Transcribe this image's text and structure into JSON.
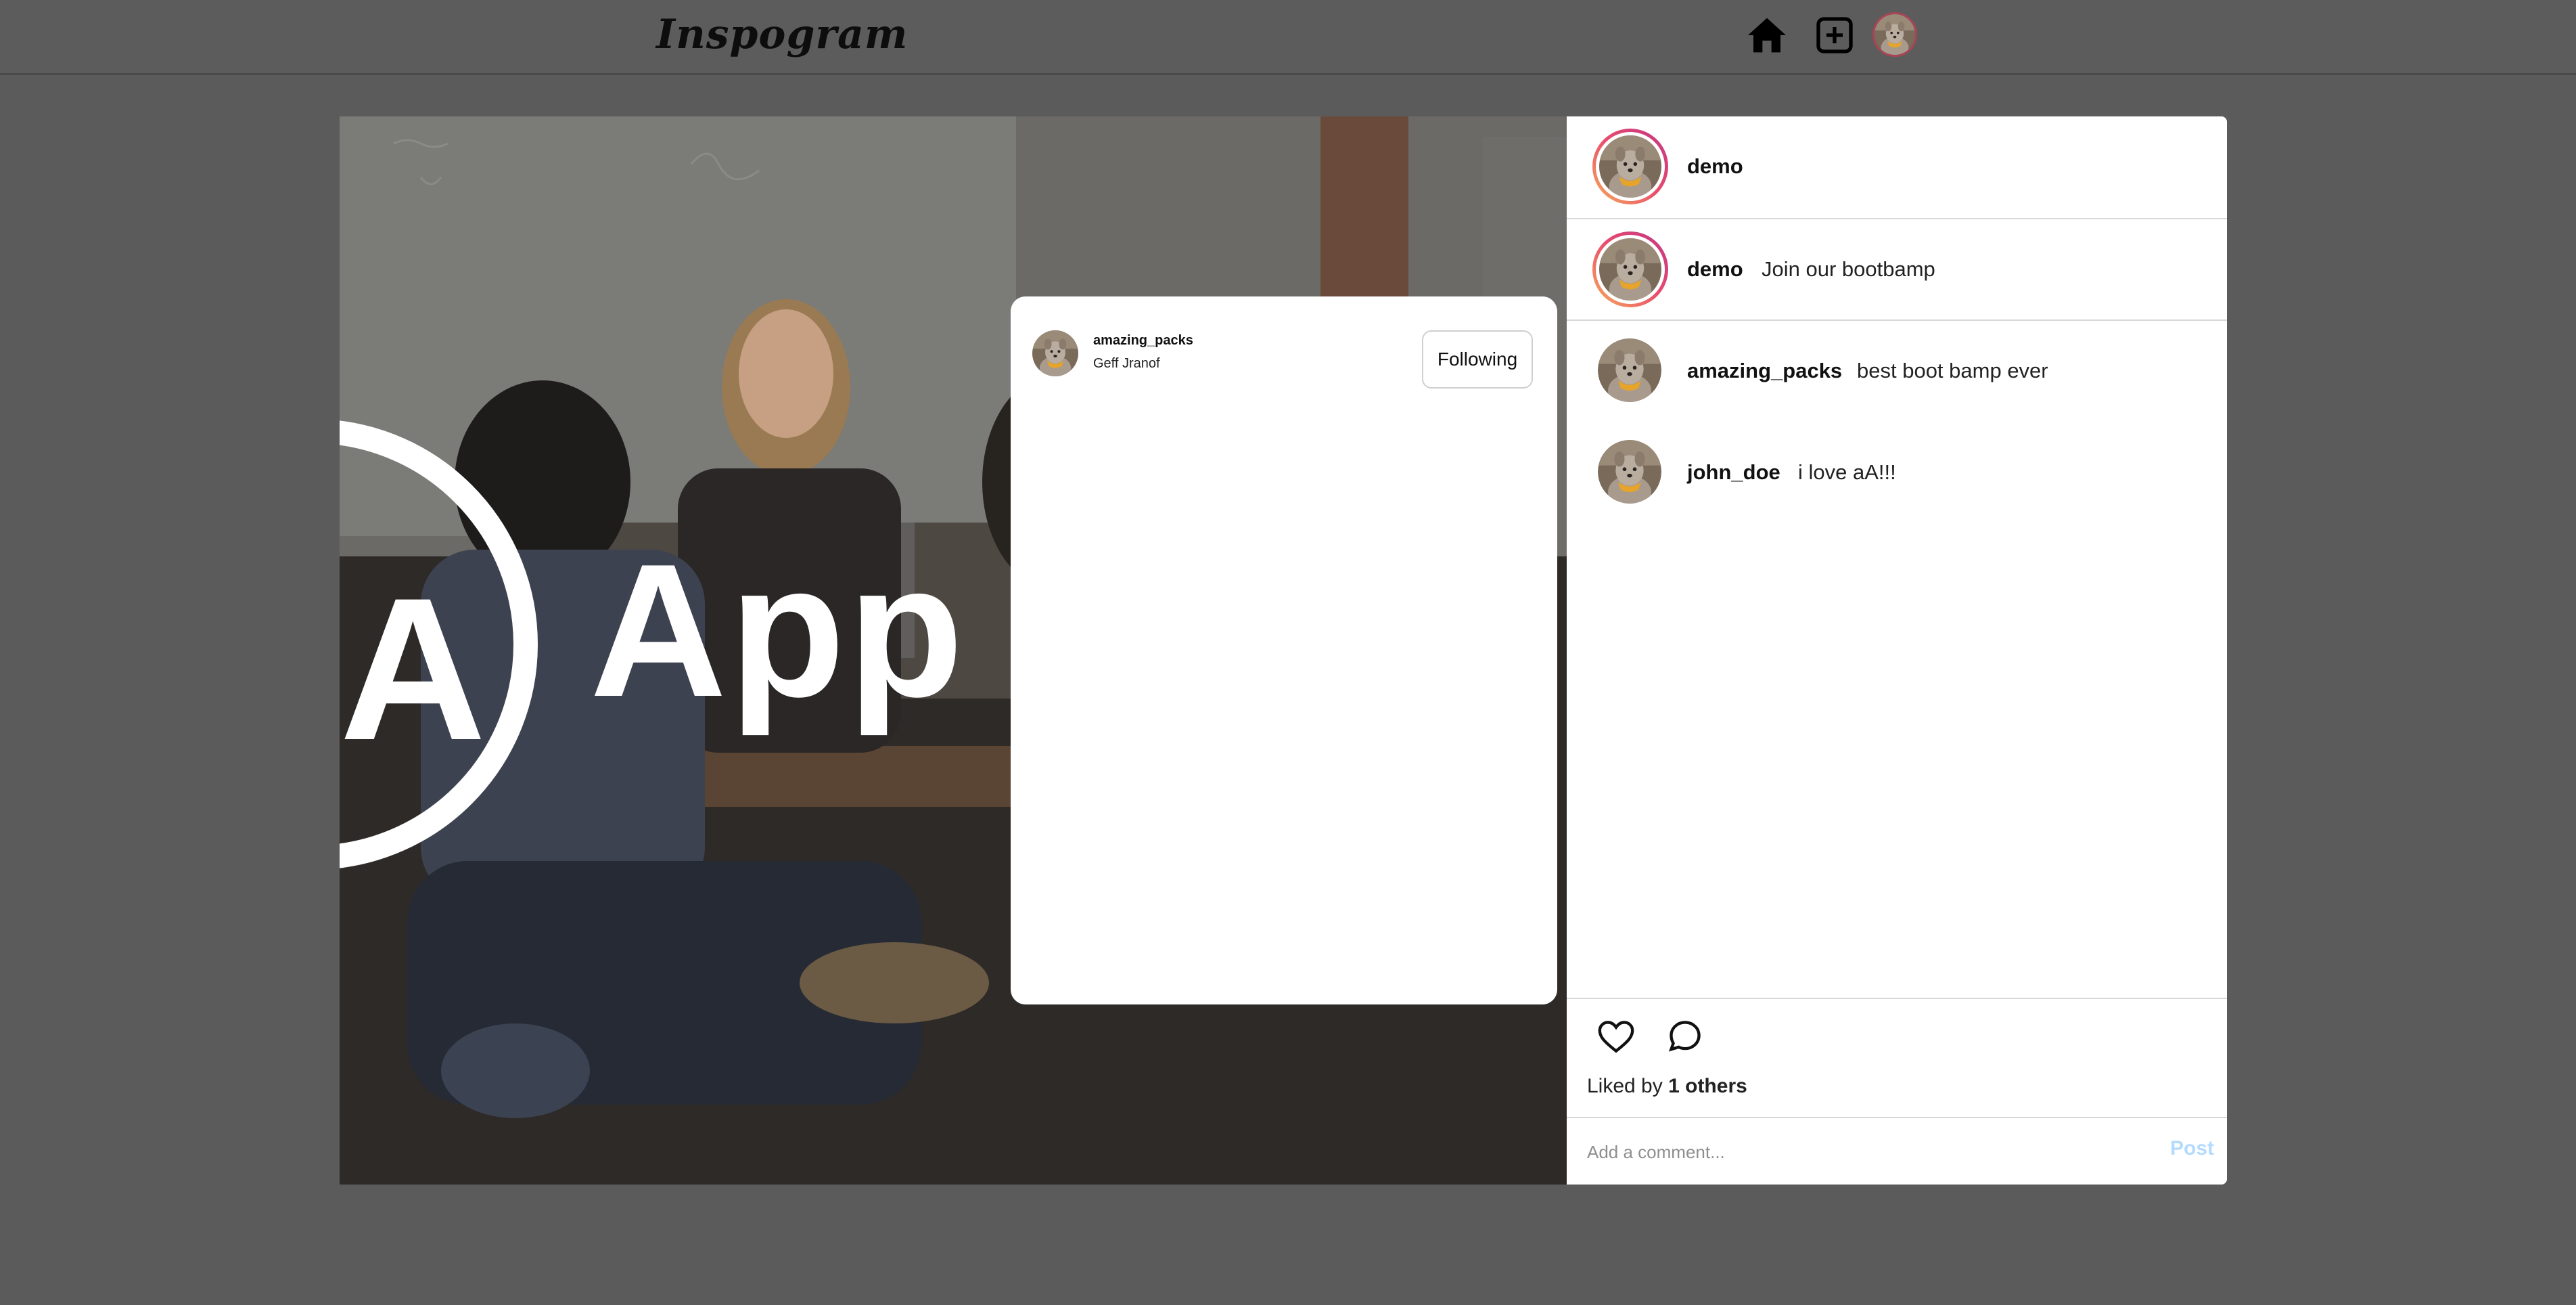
{
  "app": {
    "logo_text": "Inspogram",
    "nav_icons": [
      "home-icon",
      "add-post-icon",
      "profile-avatar"
    ]
  },
  "post": {
    "image_text": "App A",
    "author": "demo",
    "caption": {
      "username": "demo",
      "text": "Join our bootbamp"
    },
    "comments": [
      {
        "username": "amazing_packs",
        "text": "best boot bamp ever"
      },
      {
        "username": "john_doe",
        "text": "i love aA!!!"
      }
    ],
    "likes": {
      "prefix": "Liked by",
      "count_label": "1 others"
    },
    "comment_placeholder": "Add a comment...",
    "post_label": "Post"
  },
  "modal": {
    "entries": [
      {
        "username": "amazing_packs",
        "full_name": "Geff Jranof",
        "button_label": "Following"
      }
    ]
  },
  "colors": {
    "backdrop": "#5b5b5b",
    "ring_gradient": [
      "#f6b05a",
      "#ea4d6c",
      "#c13584"
    ],
    "post_button_disabled": "#b3dbff"
  }
}
